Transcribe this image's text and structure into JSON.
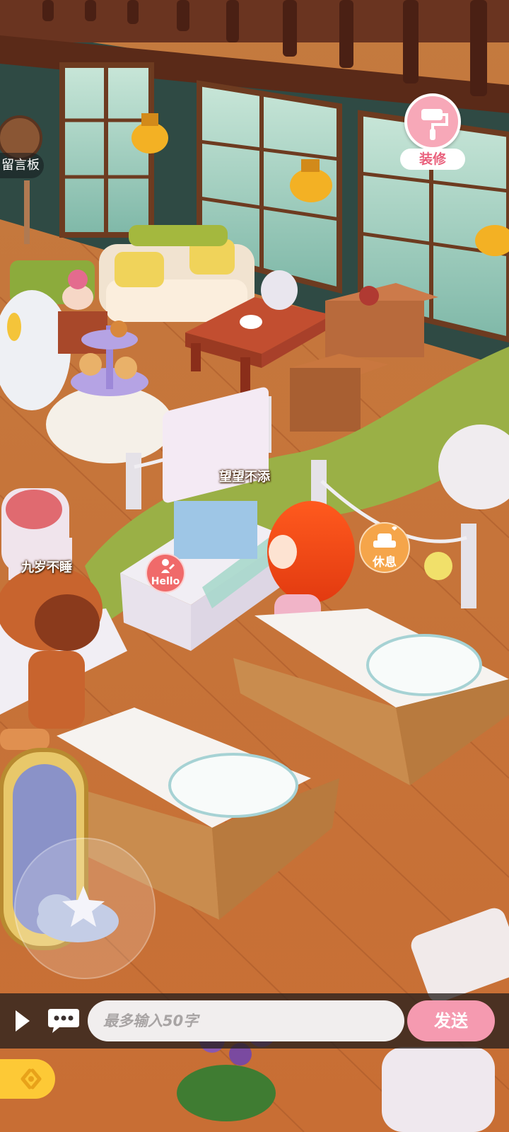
{
  "hud": {
    "decorate_label": "装修",
    "message_board_label": "留言板",
    "hello_label": "Hello",
    "rest_label": "休息"
  },
  "players": [
    {
      "name": "望望不添"
    },
    {
      "name": "九岁不睡"
    }
  ],
  "chat": {
    "placeholder": "最多输入50字",
    "send_label": "发送"
  },
  "colors": {
    "floor": "#c8743b",
    "decorate_pink": "#f7a8b8",
    "send_pink": "#f59ab0",
    "rest_orange": "#f5a54a",
    "hello_red": "#f06a6a",
    "exit_yellow": "#fdc936"
  },
  "icons": {
    "decorate": "paint-roller-icon",
    "rest": "armchair-icon",
    "hello": "waving-person-icon",
    "play": "play-triangle-icon",
    "chat": "speech-bubble-icon",
    "exit": "exit-arrow-icon",
    "joystick": "cloud-star-icon"
  }
}
